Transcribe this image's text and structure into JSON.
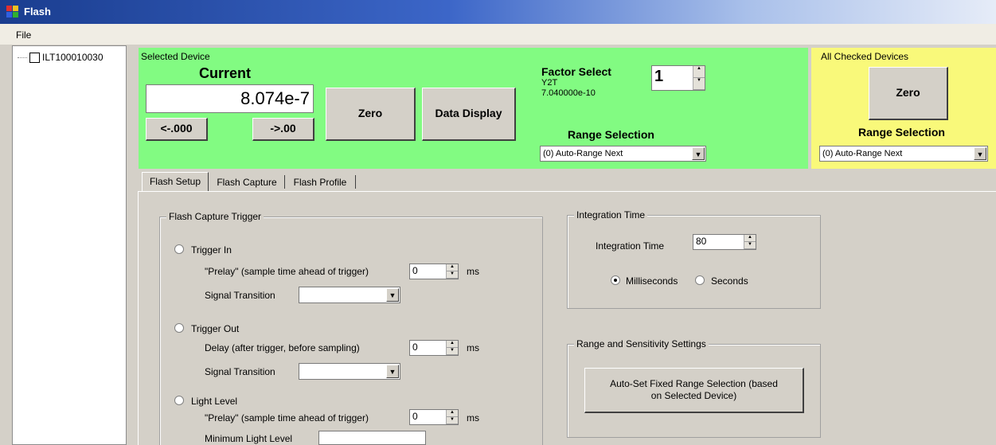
{
  "window": {
    "title": "Flash"
  },
  "menu": {
    "file": "File"
  },
  "tree": {
    "device": "ILT100010030"
  },
  "selected_device": {
    "group_label": "Selected Device",
    "current_label": "Current",
    "current_value": "8.074e-7",
    "decrease_decimal": "<-.000",
    "increase_decimal": "->.00",
    "zero_button": "Zero",
    "data_display_button": "Data Display",
    "factor_select_label": "Factor Select",
    "factor_name": "Y2T",
    "factor_value": "7.040000e-10",
    "factor_select_value": "1",
    "range_selection_label": "Range Selection",
    "range_selection_value": "(0) Auto-Range Next"
  },
  "all_checked": {
    "group_label": "All Checked Devices",
    "zero_button": "Zero",
    "range_selection_label": "Range Selection",
    "range_selection_value": "(0) Auto-Range Next"
  },
  "tabs": [
    {
      "label": "Flash Setup",
      "active": true
    },
    {
      "label": "Flash Capture",
      "active": false
    },
    {
      "label": "Flash Profile",
      "active": false
    }
  ],
  "flash_capture_trigger": {
    "title": "Flash Capture Trigger",
    "trigger_in": {
      "label": "Trigger In",
      "prelay_label": "\"Prelay\" (sample time ahead of trigger)",
      "prelay_value": "0",
      "prelay_unit": "ms",
      "signal_transition_label": "Signal Transition",
      "signal_transition_value": ""
    },
    "trigger_out": {
      "label": "Trigger Out",
      "delay_label": "Delay (after trigger, before sampling)",
      "delay_value": "0",
      "delay_unit": "ms",
      "signal_transition_label": "Signal Transition",
      "signal_transition_value": ""
    },
    "light_level": {
      "label": "Light Level",
      "prelay_label": "\"Prelay\" (sample time ahead of trigger)",
      "prelay_value": "0",
      "prelay_unit": "ms",
      "min_light_label": "Minimum Light Level",
      "min_light_value": ""
    }
  },
  "integration_time": {
    "title": "Integration Time",
    "label": "Integration Time",
    "value": "80",
    "unit_ms": "Milliseconds",
    "unit_s": "Seconds",
    "selected_unit": "Milliseconds"
  },
  "range_sensitivity": {
    "title": "Range and Sensitivity Settings",
    "auto_set_button": "Auto-Set Fixed Range Selection (based on Selected Device)"
  },
  "colors": {
    "selected_device_bg": "#82fb82",
    "all_checked_bg": "#f9f97a",
    "window_bg": "#d4d0c8"
  }
}
